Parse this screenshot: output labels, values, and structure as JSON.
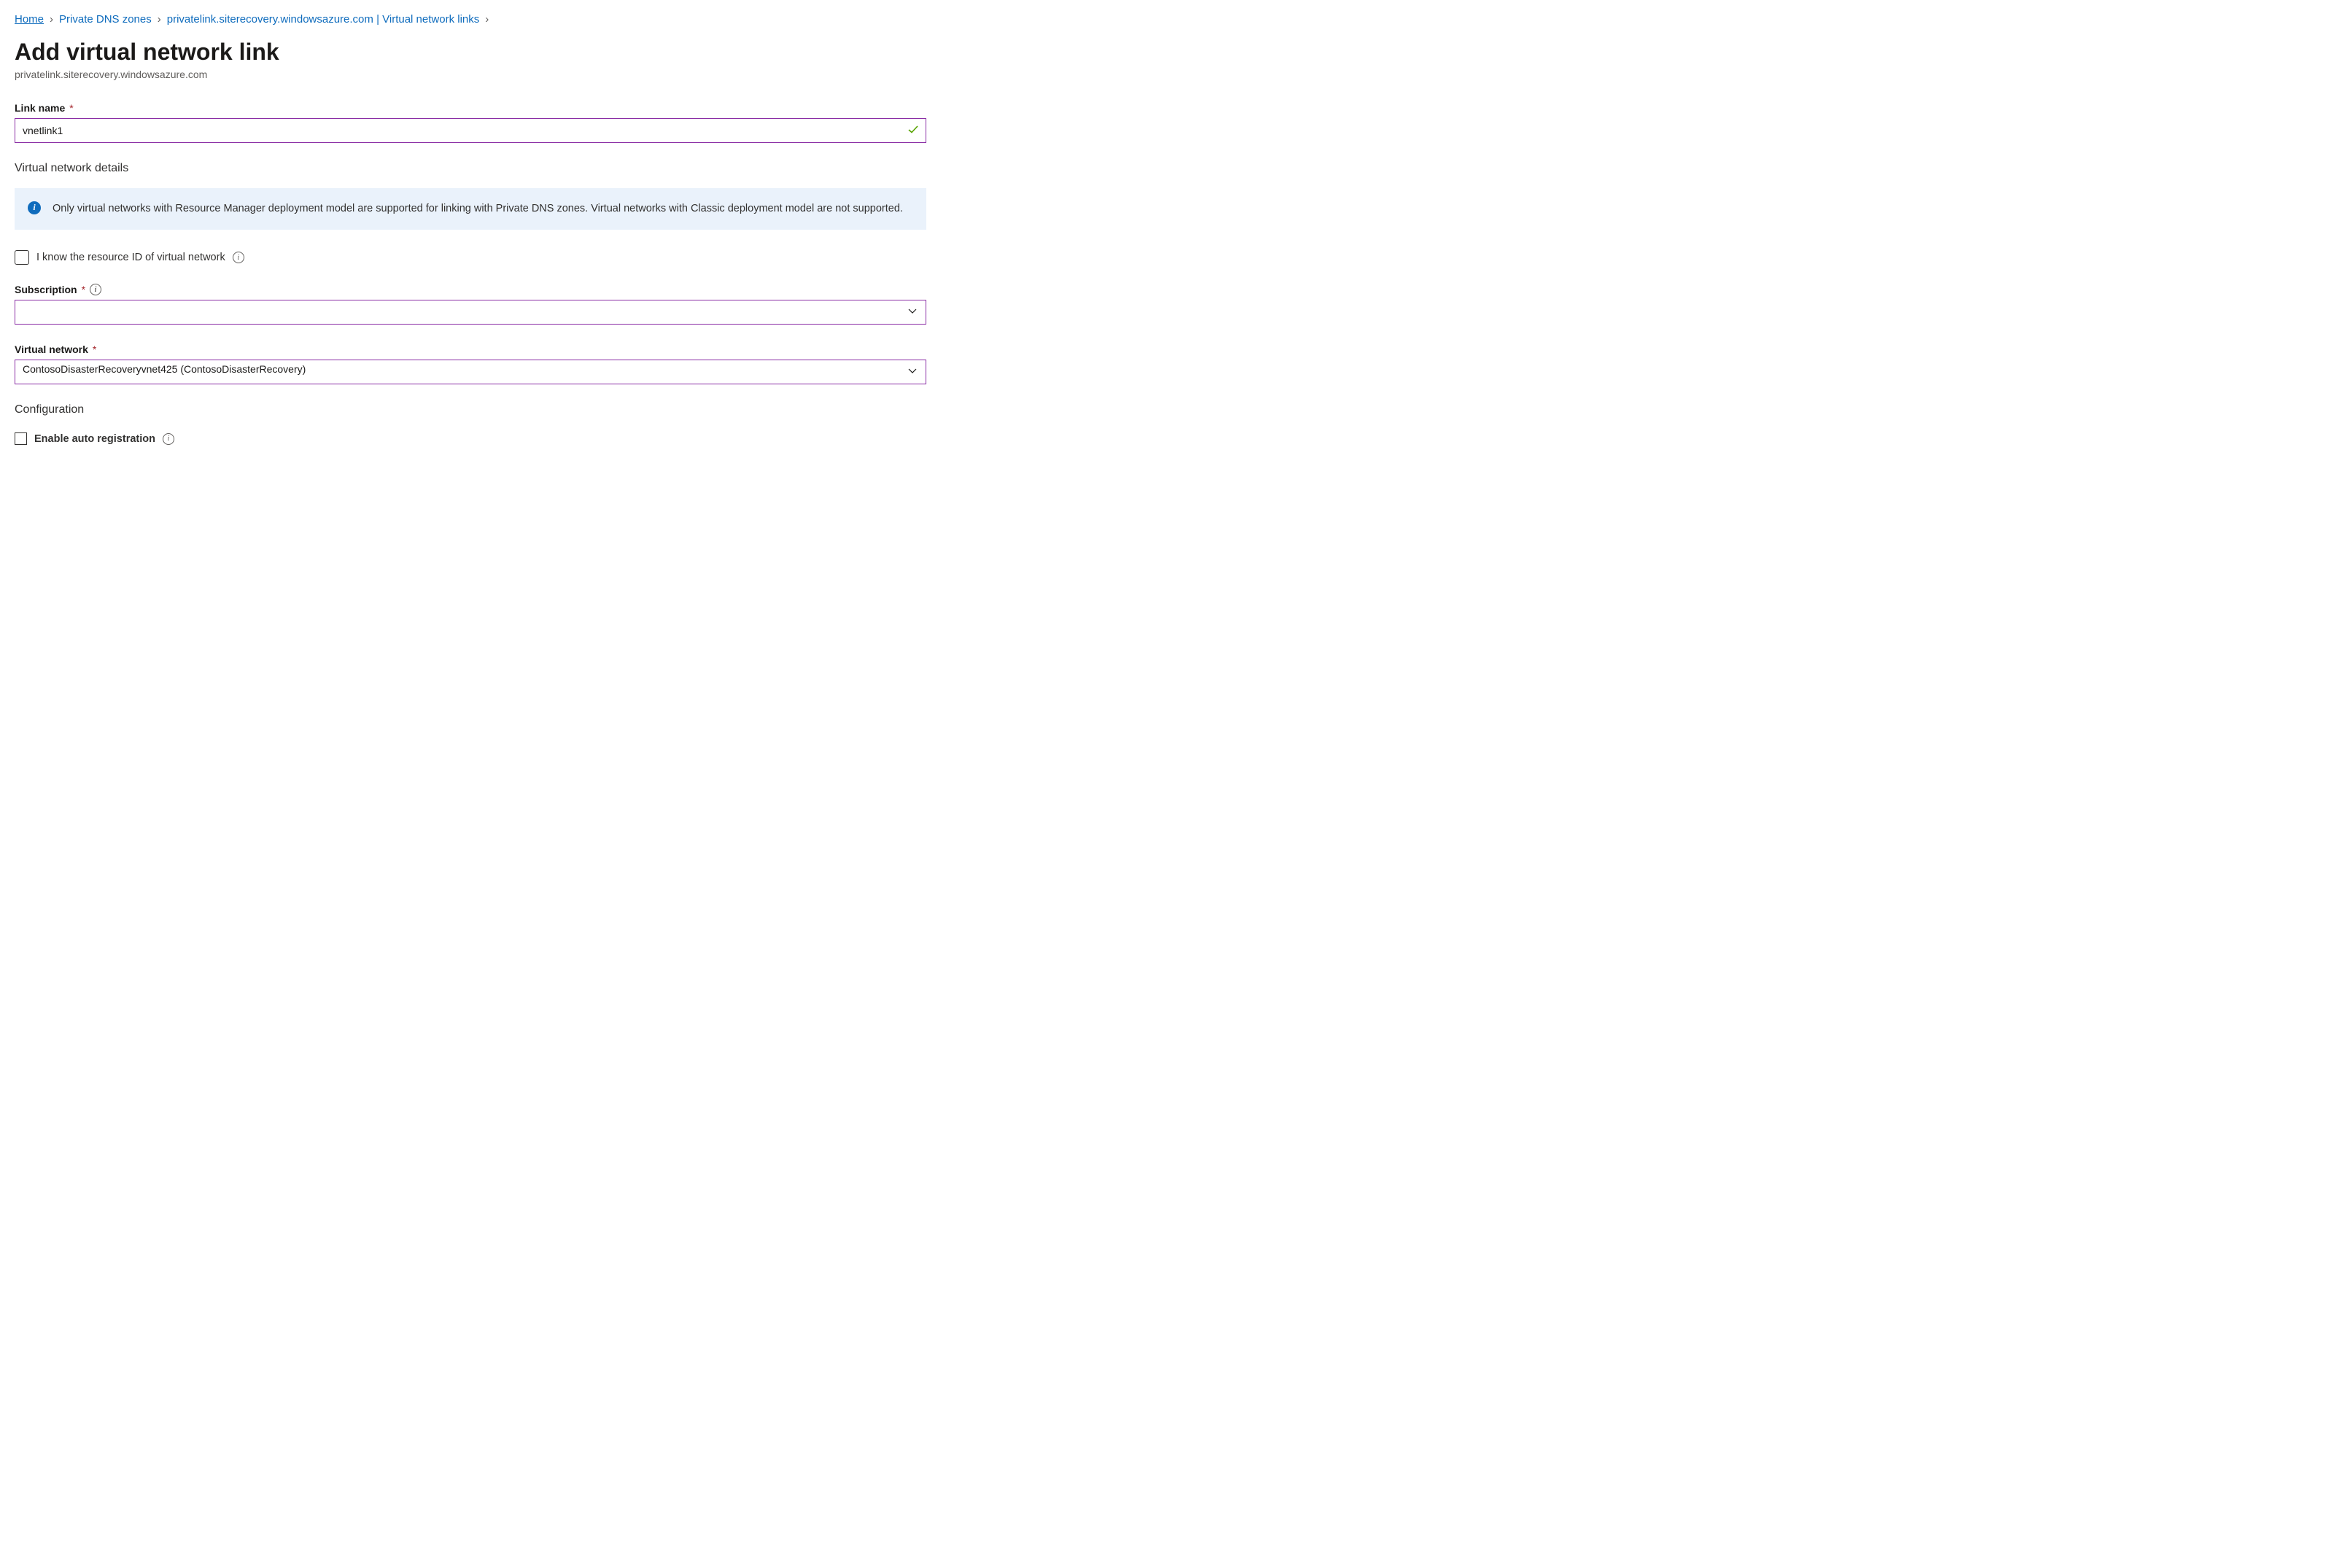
{
  "breadcrumb": {
    "home": "Home",
    "dnszones": "Private DNS zones",
    "zone_links": "privatelink.siterecovery.windowsazure.com | Virtual network links"
  },
  "page": {
    "title": "Add virtual network link",
    "subtitle": "privatelink.siterecovery.windowsazure.com"
  },
  "fields": {
    "link_name": {
      "label": "Link name",
      "value": "vnetlink1"
    },
    "vnet_details_heading": "Virtual network details",
    "info_box_text": "Only virtual networks with Resource Manager deployment model are supported for linking with Private DNS zones. Virtual networks with Classic deployment model are not supported.",
    "know_resource_id_label": "I know the resource ID of virtual network",
    "subscription": {
      "label": "Subscription",
      "value": ""
    },
    "virtual_network": {
      "label": "Virtual network",
      "value": "ContosoDisasterRecoveryvnet425 (ContosoDisasterRecovery)"
    },
    "configuration_heading": "Configuration",
    "enable_auto_reg_label": "Enable auto registration"
  }
}
